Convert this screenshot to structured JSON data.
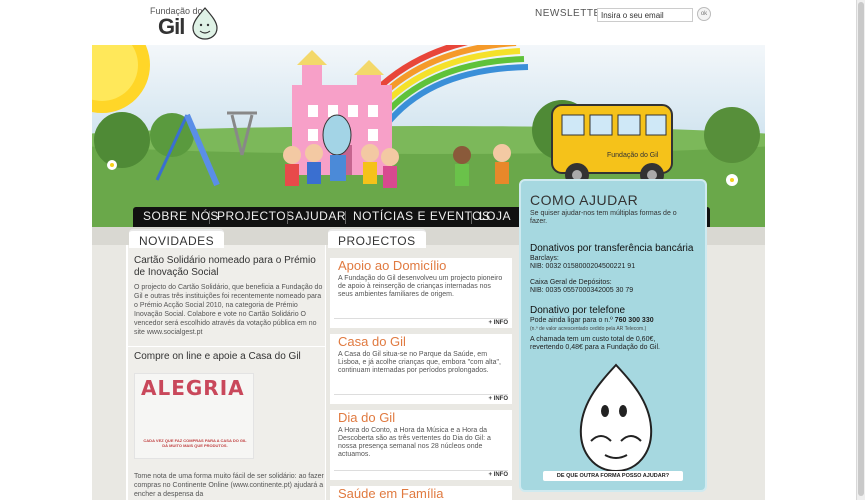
{
  "header": {
    "logo_top": "Fundação do",
    "logo_main": "Gil",
    "newsletter_label": "NEWSLETTER:",
    "newsletter_placeholder": "Insira o seu email",
    "newsletter_button": "ok"
  },
  "hero": {
    "bus_label": "Fundação do Gil"
  },
  "nav": {
    "items": [
      "SOBRE NÓS",
      "PROJECTOS",
      "AJUDAR",
      "NOTÍCIAS E EVENTOS",
      "LOJA"
    ]
  },
  "tabs": {
    "novidades": "NOVIDADES",
    "projectos": "PROJECTOS"
  },
  "novidades": [
    {
      "title": "Cartão Solidário nomeado para o Prémio de Inovação Social",
      "body": "O projecto do Cartão Solidário, que beneficia a Fundação do Gil e outras três instituições foi recentemente nomeado para o Prémio Acção Social 2010, na categoria de Prémio Inovação Social. Colabore e vote no Cartão Solidário O vencedor será escolhido através da votação pública em no site www.socialgest.pt"
    },
    {
      "title": "Compre on line e apoie a Casa do Gil",
      "image_word": "ALEGRIA",
      "image_caption": "CADA VEZ QUE FAZ COMPRAS PARA A CASA DO GIL DÁ MUITO MAIS QUE PRODUTOS.",
      "body": "Tome nota de uma forma muito fácil de ser solidário: ao fazer compras no Continente Online (www.continente.pt) ajudará a encher a despensa da"
    }
  ],
  "projectos": [
    {
      "title": "Apoio ao Domicílio",
      "body": "A Fundação do Gil desenvolveu um projecto pioneiro de apoio à reinserção de crianças internadas nos seus ambientes familiares de origem.",
      "more": "+ INFO"
    },
    {
      "title": "Casa do Gil",
      "body": "A Casa do Gil situa-se no Parque da Saúde, em Lisboa, e já acolhe crianças que, embora \"com alta\", continuam internadas por períodos prolongados.",
      "more": "+ INFO"
    },
    {
      "title": "Dia do Gil",
      "body": "A Hora do Conto, a Hora da Música e a Hora da Descoberta são as três vertentes do Dia do Gil: a nossa presença semanal nos 28 núcleos onde actuamos.",
      "more": "+ INFO"
    },
    {
      "title": "Saúde em Família"
    }
  ],
  "como_ajudar": {
    "title": "COMO AJUDAR",
    "subtitle": "Se quiser ajudar-nos tem múltiplas formas de o fazer.",
    "transfer_heading": "Donativos por transferência bancária",
    "barclays_label": "Barclays:",
    "barclays_nib": "NIB: 0032 0158000204500221 91",
    "cgd_label": "Caixa Geral de Depósitos:",
    "cgd_nib": "NIB: 0035 0557000342005 30 79",
    "phone_heading": "Donativo por telefone",
    "phone_text": "Pode ainda ligar para o n.º",
    "phone_number": "760 300 330",
    "phone_note": "(n.º de valor acrescentado cedido pela AR Telecom.)",
    "cost_text": "A chamada tem um custo total de 0,60€, revertendo 0,48€ para a Fundação do Gil.",
    "cta": "DE QUE OUTRA FORMA POSSO AJUDAR?"
  },
  "colors": {
    "nav_bg": "#111111",
    "accent_orange": "#e07a40",
    "ajudar_bg": "#a6d8e0"
  }
}
